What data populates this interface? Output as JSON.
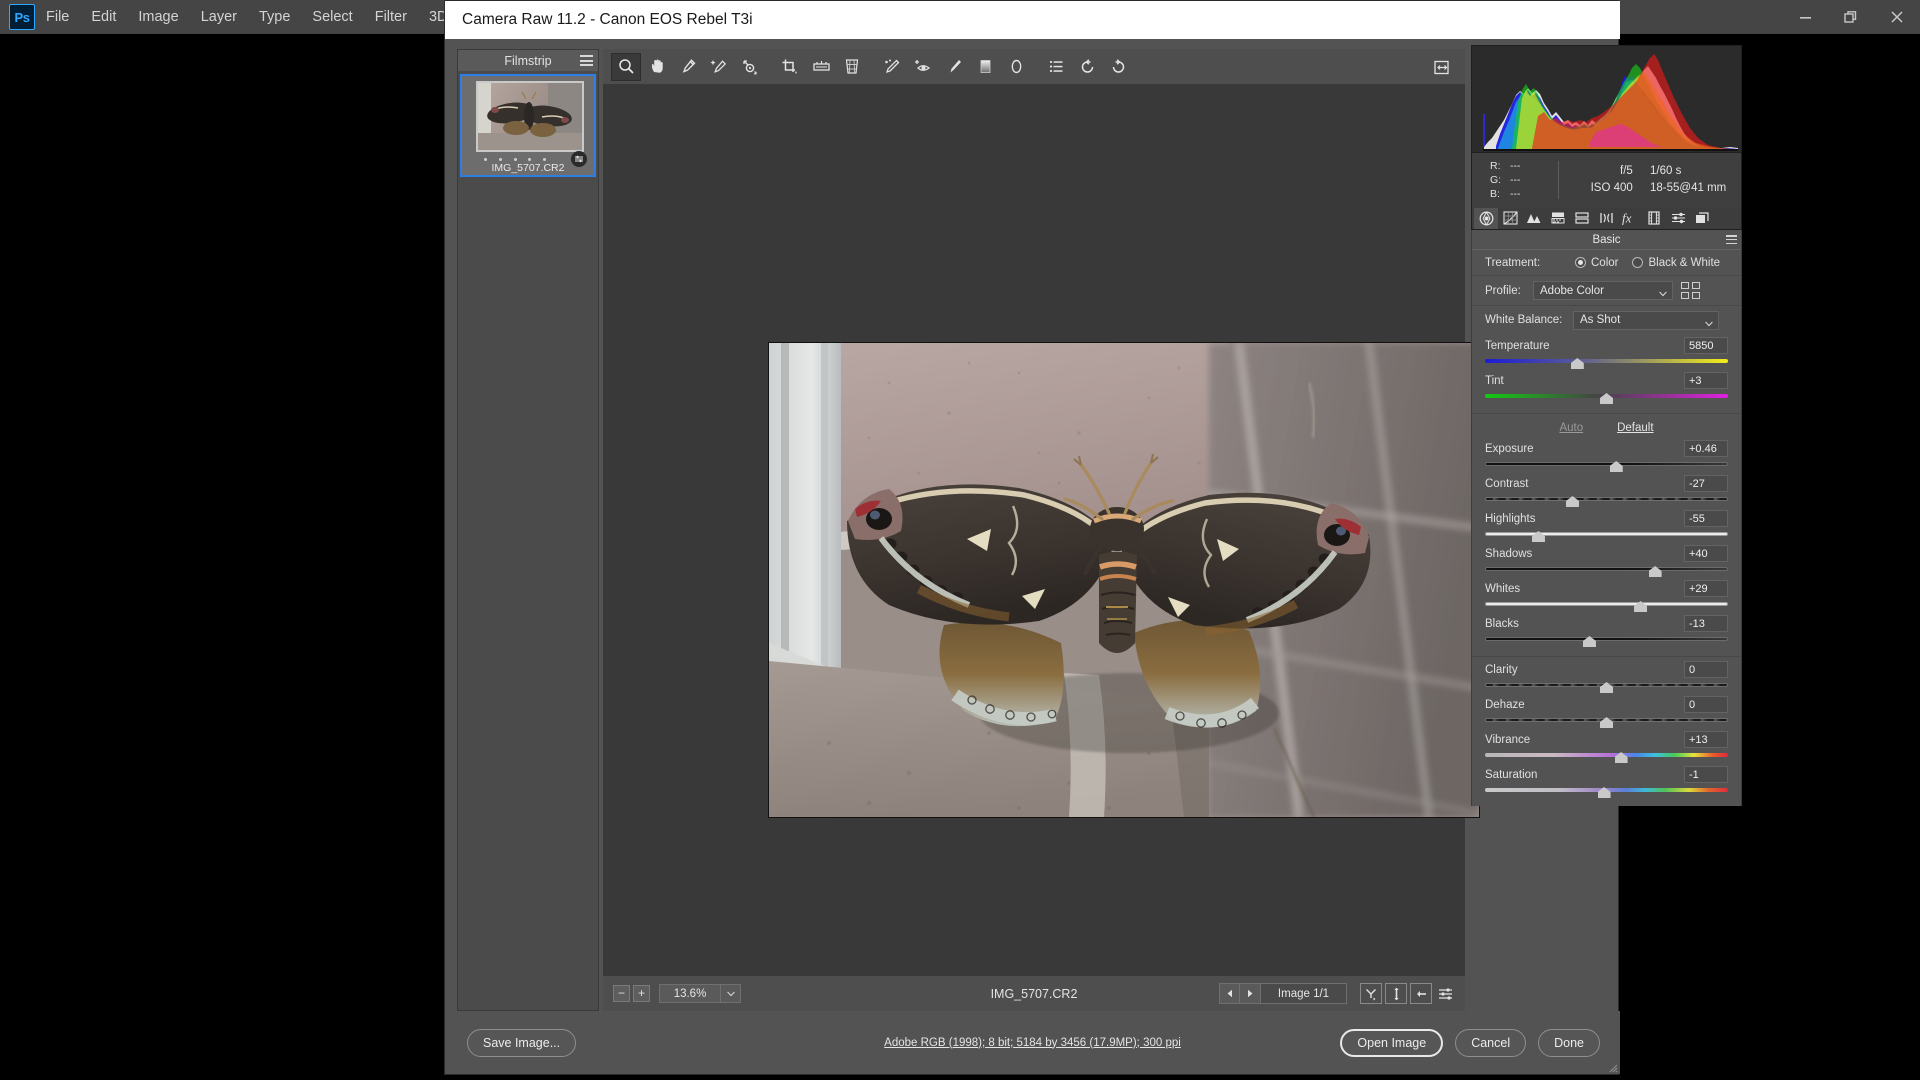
{
  "app": {
    "menubar": {
      "logo": "Ps",
      "items": [
        "File",
        "Edit",
        "Image",
        "Layer",
        "Type",
        "Select",
        "Filter",
        "3D"
      ]
    },
    "window_controls": [
      "minimize",
      "restore",
      "close"
    ]
  },
  "dialog": {
    "title": "Camera Raw 11.2  -  Canon EOS Rebel T3i"
  },
  "filmstrip": {
    "header": "Filmstrip",
    "menu_icon": "hamburger-icon",
    "thumbnails": [
      {
        "filename": "IMG_5707.CR2",
        "rating_dots": 5,
        "badge": "edit-settings-icon",
        "selected": true
      }
    ]
  },
  "toolbar": {
    "tools": [
      {
        "name": "zoom-tool-icon",
        "glyph": "zoom",
        "active": true
      },
      {
        "name": "hand-tool-icon",
        "glyph": "hand",
        "active": false
      },
      {
        "name": "white-balance-tool-icon",
        "glyph": "eyedropper",
        "active": false
      },
      {
        "name": "color-sampler-tool-icon",
        "glyph": "eyedropper-sparkle",
        "active": false
      },
      {
        "name": "targeted-adjustment-tool-icon",
        "glyph": "target-adjust",
        "active": false
      },
      {
        "name": "crop-tool-icon",
        "glyph": "crop",
        "active": false
      },
      {
        "name": "straighten-tool-icon",
        "glyph": "straighten",
        "active": false
      },
      {
        "name": "transform-tool-icon",
        "glyph": "transform",
        "active": false
      },
      {
        "name": "spot-removal-tool-icon",
        "glyph": "spot-heal",
        "active": false
      },
      {
        "name": "red-eye-removal-tool-icon",
        "glyph": "red-eye",
        "active": false
      },
      {
        "name": "adjustment-brush-tool-icon",
        "glyph": "brush",
        "active": false
      },
      {
        "name": "graduated-filter-tool-icon",
        "glyph": "graduated",
        "active": false
      },
      {
        "name": "radial-filter-tool-icon",
        "glyph": "radial",
        "active": false
      },
      {
        "name": "preferences-tool-icon",
        "glyph": "preferences",
        "active": false
      },
      {
        "name": "rotate-counterclockwise-icon",
        "glyph": "rotate-ccw",
        "active": false
      },
      {
        "name": "rotate-clockwise-icon",
        "glyph": "rotate-cw",
        "active": false
      }
    ],
    "fullscreen_toggle": "toggle-fullscreen-icon"
  },
  "statusbar": {
    "zoom_out": "−",
    "zoom_in": "+",
    "zoom_level": "13.6%",
    "filename": "IMG_5707.CR2",
    "prev_arrow": "◀",
    "next_arrow": "▶",
    "image_counter": "Image 1/1",
    "icons": [
      "synchronize-icon",
      "select-all-icon",
      "sync-settings-icon",
      "filter-settings-icon"
    ]
  },
  "histogram": {
    "shadow_clipping_indicator": "on",
    "highlight_clipping_indicator": "off",
    "readout": {
      "R": "---",
      "G": "---",
      "B": "---"
    },
    "exif": {
      "aperture": "f/5",
      "shutter": "1/60 s",
      "iso": "ISO 400",
      "lens": "18-55@41 mm"
    }
  },
  "panel_tabs": [
    {
      "name": "tab-basic",
      "icon": "aperture-icon",
      "active": true
    },
    {
      "name": "tab-tone-curve",
      "icon": "tone-curve-icon",
      "active": false
    },
    {
      "name": "tab-detail",
      "icon": "detail-triangles-icon",
      "active": false
    },
    {
      "name": "tab-hsl-grayscale",
      "icon": "hsl-bars-icon",
      "active": false
    },
    {
      "name": "tab-split-toning",
      "icon": "split-toning-icon",
      "active": false
    },
    {
      "name": "tab-lens-corrections",
      "icon": "lens-correction-icon",
      "active": false
    },
    {
      "name": "tab-effects",
      "icon": "fx-icon",
      "active": false
    },
    {
      "name": "tab-calibration",
      "icon": "filmstrip-icon",
      "active": false
    },
    {
      "name": "tab-presets",
      "icon": "presets-sliders-icon",
      "active": false
    },
    {
      "name": "tab-snapshots",
      "icon": "snapshots-icon",
      "active": false
    }
  ],
  "basic_panel": {
    "title": "Basic",
    "menu_icon": "panel-menu-icon",
    "treatment": {
      "label": "Treatment:",
      "options": [
        {
          "label": "Color",
          "selected": true
        },
        {
          "label": "Black & White",
          "selected": false
        }
      ]
    },
    "profile": {
      "label": "Profile:",
      "value": "Adobe Color",
      "browse_icon": "profile-browser-icon"
    },
    "white_balance": {
      "label": "White Balance:",
      "value": "As Shot"
    },
    "auto_label": "Auto",
    "default_label": "Default",
    "sliders": [
      {
        "name": "Temperature",
        "value": "5850",
        "pos": 38,
        "track": "temp",
        "group": "wb"
      },
      {
        "name": "Tint",
        "value": "+3",
        "pos": 50,
        "track": "tint",
        "group": "wb"
      },
      {
        "name": "Exposure",
        "value": "+0.46",
        "pos": 54,
        "track": "dark",
        "group": "tone"
      },
      {
        "name": "Contrast",
        "value": "-27",
        "pos": 36,
        "track": "contrast",
        "group": "tone"
      },
      {
        "name": "Highlights",
        "value": "-55",
        "pos": 22,
        "track": "light",
        "group": "tone"
      },
      {
        "name": "Shadows",
        "value": "+40",
        "pos": 70,
        "track": "dark",
        "group": "tone"
      },
      {
        "name": "Whites",
        "value": "+29",
        "pos": 64,
        "track": "light",
        "group": "tone"
      },
      {
        "name": "Blacks",
        "value": "-13",
        "pos": 43,
        "track": "dark",
        "group": "tone"
      },
      {
        "name": "Clarity",
        "value": "0",
        "pos": 50,
        "track": "contrast",
        "group": "presence"
      },
      {
        "name": "Dehaze",
        "value": "0",
        "pos": 50,
        "track": "contrast",
        "group": "presence"
      },
      {
        "name": "Vibrance",
        "value": "+13",
        "pos": 56,
        "track": "vibrance",
        "group": "presence"
      },
      {
        "name": "Saturation",
        "value": "-1",
        "pos": 49,
        "track": "saturation",
        "group": "presence"
      }
    ]
  },
  "bottom_bar": {
    "save_image": "Save Image...",
    "workflow_options": "Adobe RGB (1998); 8 bit; 5184 by 3456 (17.9MP); 300 ppi",
    "open_image": "Open Image",
    "cancel": "Cancel",
    "done": "Done"
  },
  "colors": {
    "accent_blue": "#2d7ee8",
    "ps_logo_blue": "#31a8ff",
    "panel_bg": "#535353",
    "canvas_bg": "#393939",
    "titlebar_bg": "#ffffff"
  }
}
